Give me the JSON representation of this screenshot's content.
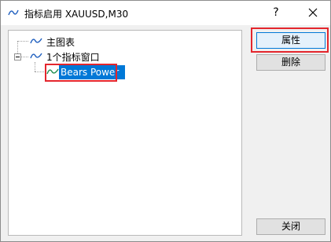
{
  "window": {
    "title": "指标启用 XAUUSD,M30",
    "help_label": "?"
  },
  "tree": {
    "items": [
      {
        "label": "主图表"
      },
      {
        "label": "1个指标窗口"
      },
      {
        "label": "Bears Power"
      }
    ]
  },
  "buttons": {
    "properties": "属性",
    "delete": "删除",
    "close": "关闭"
  },
  "colors": {
    "selection": "#0078d7",
    "highlight_box": "#e4262d",
    "icon": "#1f5fbf"
  }
}
